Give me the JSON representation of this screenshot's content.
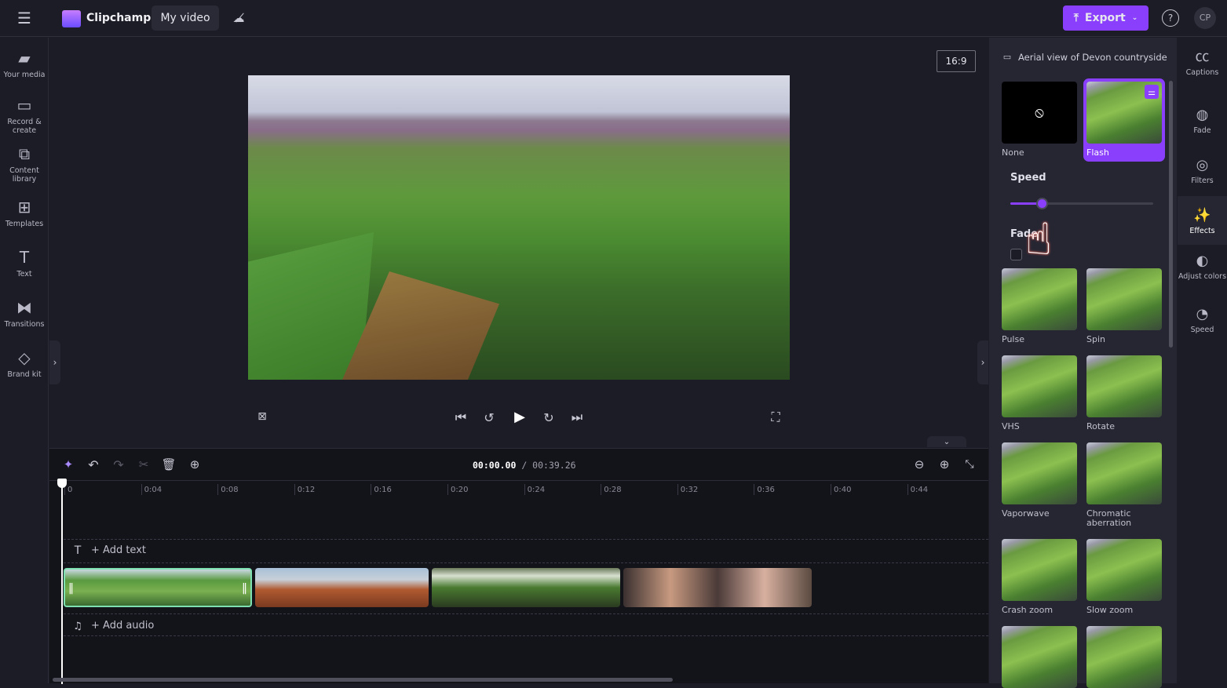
{
  "app": {
    "name": "Clipchamp",
    "project_title": "My video",
    "export_label": "Export",
    "avatar": "CP",
    "accent": "#8a3ffc"
  },
  "sidebar": {
    "items": [
      {
        "icon": "folder-icon",
        "label": "Your media"
      },
      {
        "icon": "camera-icon",
        "label": "Record & create"
      },
      {
        "icon": "content-library-icon",
        "label": "Content library"
      },
      {
        "icon": "templates-icon",
        "label": "Templates"
      },
      {
        "icon": "text-icon",
        "label": "Text"
      },
      {
        "icon": "transitions-icon",
        "label": "Transitions"
      },
      {
        "icon": "brand-kit-icon",
        "label": "Brand kit"
      }
    ]
  },
  "preview": {
    "aspect_ratio": "16:9"
  },
  "timeline": {
    "current_time": "00:00.00",
    "total_time": "/ 00:39.26",
    "ticks": [
      "0",
      "0:04",
      "0:08",
      "0:12",
      "0:16",
      "0:20",
      "0:24",
      "0:28",
      "0:32",
      "0:36",
      "0:40",
      "0:44"
    ],
    "add_text": "+ Add text",
    "add_audio": "+ Add audio"
  },
  "panel": {
    "title": "Aerial view of Devon countryside",
    "speed_label": "Speed",
    "speed_value_fraction": 0.22,
    "fade_label": "Fade",
    "fade_checked": false,
    "effects": [
      "None",
      "Flash",
      "Pulse",
      "Spin",
      "VHS",
      "Rotate",
      "Vaporwave",
      "Chromatic aberration",
      "Crash zoom",
      "Slow zoom"
    ],
    "selected": "Flash"
  },
  "rail": {
    "items": [
      {
        "icon": "captions-icon",
        "label": "Captions"
      },
      {
        "icon": "fade-icon",
        "label": "Fade"
      },
      {
        "icon": "filters-icon",
        "label": "Filters"
      },
      {
        "icon": "effects-icon",
        "label": "Effects"
      },
      {
        "icon": "adjust-colors-icon",
        "label": "Adjust colors"
      },
      {
        "icon": "speed-icon",
        "label": "Speed"
      }
    ]
  }
}
